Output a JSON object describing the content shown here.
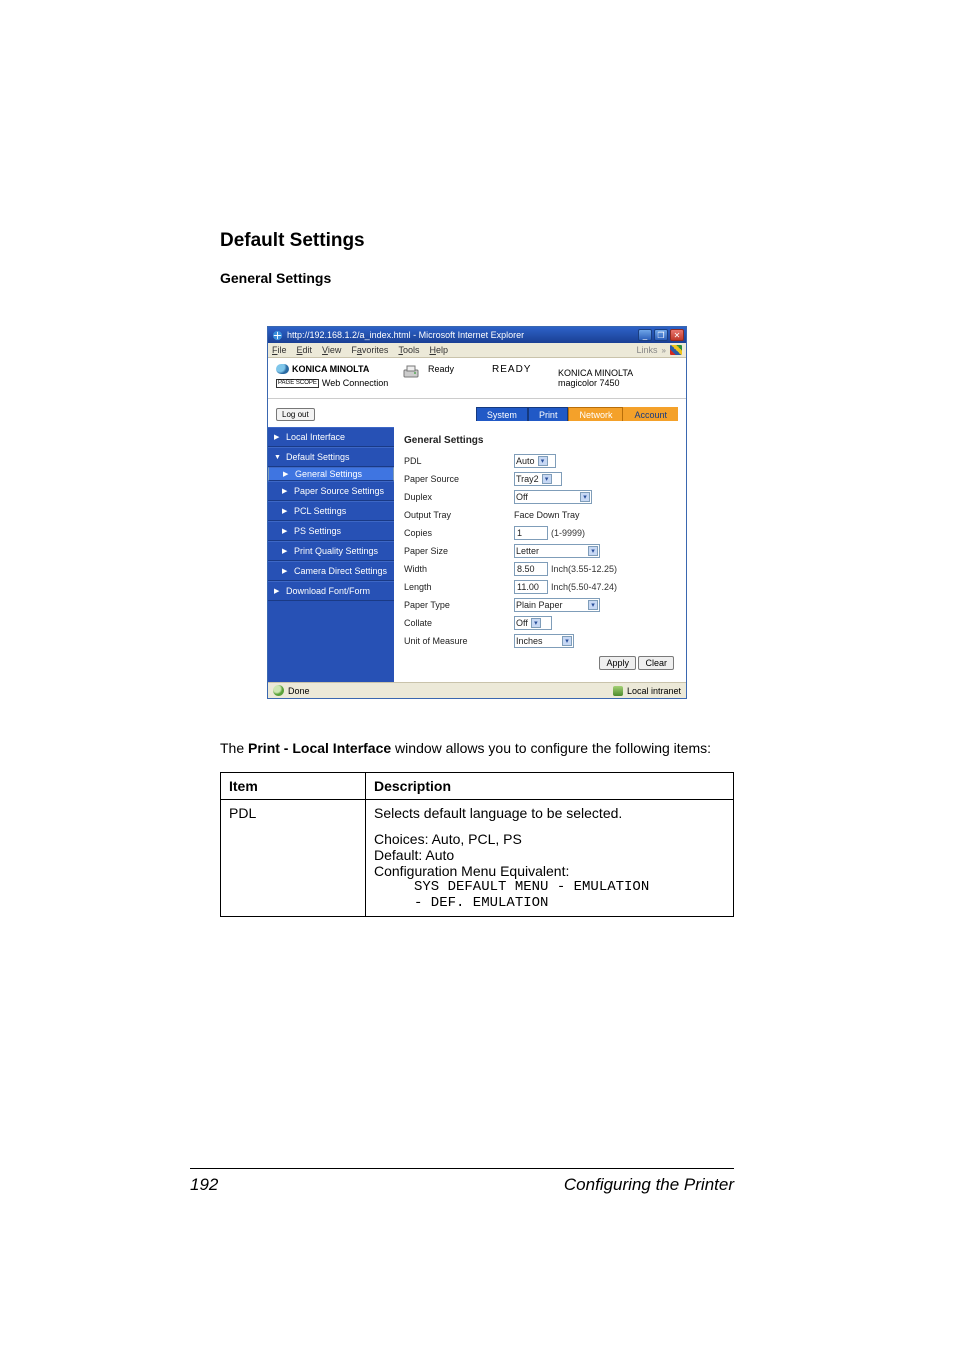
{
  "headings": {
    "h1": "Default Settings",
    "h2": "General Settings"
  },
  "browser": {
    "title": "http://192.168.1.2/a_index.html - Microsoft Internet Explorer",
    "menus": [
      "File",
      "Edit",
      "View",
      "Favorites",
      "Tools",
      "Help"
    ],
    "links_label": "Links",
    "win_min": "_",
    "win_max": "❐",
    "win_close": "✕"
  },
  "header": {
    "brand": "KONICA MINOLTA",
    "pagescope_badge": "PAGE SCOPE",
    "pagescope": "Web Connection",
    "status_label": "Ready",
    "status_main": "READY",
    "device_brand": "KONICA MINOLTA",
    "device_model": "magicolor 7450",
    "logout": "Log out",
    "tabs": {
      "system": "System",
      "print": "Print",
      "network": "Network",
      "account": "Account"
    }
  },
  "sidebar": {
    "local_interface": "Local Interface",
    "default_settings": "Default Settings",
    "general_settings": "General Settings",
    "paper_source_settings": "Paper Source Settings",
    "pcl_settings": "PCL Settings",
    "ps_settings": "PS Settings",
    "print_quality_settings": "Print Quality Settings",
    "camera_direct_settings": "Camera Direct Settings",
    "download_font_form": "Download Font/Form"
  },
  "panel": {
    "title": "General Settings",
    "rows": {
      "pdl": {
        "label": "PDL",
        "value": "Auto"
      },
      "papersource": {
        "label": "Paper Source",
        "value": "Tray2"
      },
      "duplex": {
        "label": "Duplex",
        "value": "Off"
      },
      "outputtray": {
        "label": "Output Tray",
        "value": "Face Down Tray"
      },
      "copies": {
        "label": "Copies",
        "value": "1",
        "hint": "(1-9999)"
      },
      "papersize": {
        "label": "Paper Size",
        "value": "Letter"
      },
      "width": {
        "label": "Width",
        "value": "8.50",
        "hint": "Inch(3.55-12.25)"
      },
      "length": {
        "label": "Length",
        "value": "11.00",
        "hint": "Inch(5.50-47.24)"
      },
      "papertype": {
        "label": "Paper Type",
        "value": "Plain Paper"
      },
      "collate": {
        "label": "Collate",
        "value": "Off"
      },
      "uom": {
        "label": "Unit of Measure",
        "value": "Inches"
      }
    },
    "apply": "Apply",
    "clear": "Clear"
  },
  "statusbar": {
    "done": "Done",
    "zone": "Local intranet"
  },
  "paragraph": {
    "pre": "The ",
    "bold": "Print - Local Interface",
    "post": " window allows you to configure the following items:"
  },
  "table": {
    "head_item": "Item",
    "head_desc": "Description",
    "row1_item": "PDL",
    "row1_line1": "Selects default language to be selected.",
    "row1_line2": "Choices: Auto, PCL, PS",
    "row1_line3": "Default:  Auto",
    "row1_line4": "Configuration Menu Equivalent:",
    "row1_code1": "SYS DEFAULT MENU - EMULATION",
    "row1_code2": "- DEF. EMULATION"
  },
  "footer": {
    "page": "192",
    "section": "Configuring the Printer"
  }
}
